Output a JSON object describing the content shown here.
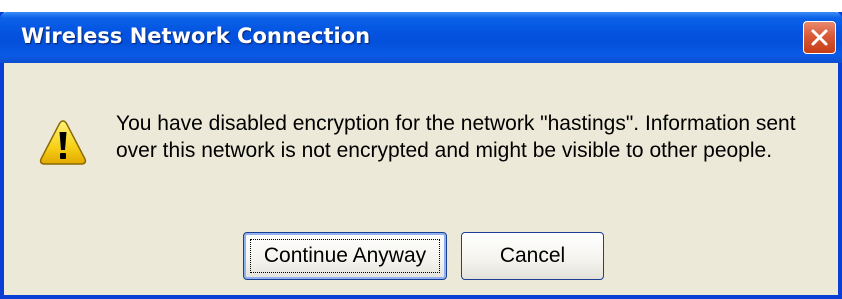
{
  "page_caption": "the bottom edge of text rendered in this strip is visible at the top of the screenshot",
  "dialog": {
    "title": "Wireless Network Connection",
    "message": "You have disabled encryption for the network \"hastings\". Information sent over this network is not encrypted and might be visible to other people.",
    "icons": {
      "close": "close-icon",
      "warning": "warning-icon"
    },
    "buttons": {
      "continue_label": "Continue Anyway",
      "cancel_label": "Cancel"
    }
  },
  "colors": {
    "titlebar": "#0453e0",
    "window_frame": "#0a3fd6",
    "dialog_background": "#ece9d8",
    "close_button": "#d95a37",
    "warning_fill": "#f7d117"
  }
}
